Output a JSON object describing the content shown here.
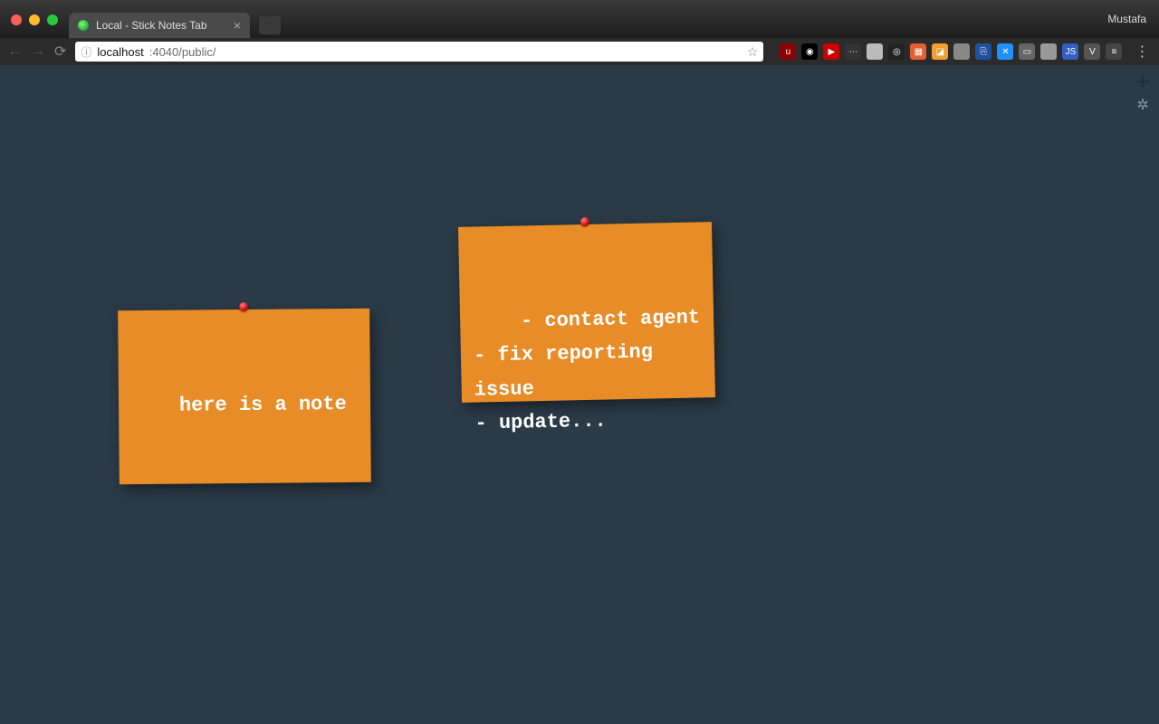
{
  "browser": {
    "tab_title": "Local - Stick Notes Tab",
    "profile_name": "Mustafa",
    "url_host": "localhost",
    "url_port_path": ":4040/public/",
    "secure_info_icon": "ⓘ",
    "star_icon": "☆"
  },
  "page_controls": {
    "add_icon": "＋",
    "settings_icon": "✲"
  },
  "notes": [
    {
      "text": "here is a note"
    },
    {
      "text": "- contact agent\n- fix reporting issue\n- update..."
    }
  ],
  "extensions": [
    {
      "name": "ublock",
      "bg": "#8b0000",
      "label": "u"
    },
    {
      "name": "ext-eye",
      "bg": "#000000",
      "label": "◉"
    },
    {
      "name": "youtube",
      "bg": "#cc0000",
      "label": "▶"
    },
    {
      "name": "ext-dots",
      "bg": "#333333",
      "label": "⋯"
    },
    {
      "name": "ext-circle",
      "bg": "#bbbbbb",
      "label": ""
    },
    {
      "name": "ext-target",
      "bg": "#222222",
      "label": "◎"
    },
    {
      "name": "ext-grid",
      "bg": "#e06030",
      "label": "▦"
    },
    {
      "name": "ext-orange",
      "bg": "#f0a030",
      "label": "◪"
    },
    {
      "name": "ext-gray1",
      "bg": "#888888",
      "label": ""
    },
    {
      "name": "ext-blue1",
      "bg": "#2050a0",
      "label": "⎘"
    },
    {
      "name": "ext-blue2",
      "bg": "#1e90ff",
      "label": "✕"
    },
    {
      "name": "ext-gray2",
      "bg": "#666666",
      "label": "▭"
    },
    {
      "name": "ext-gray3",
      "bg": "#999999",
      "label": ""
    },
    {
      "name": "ext-js",
      "bg": "#3060c0",
      "label": "JS"
    },
    {
      "name": "ext-v",
      "bg": "#555555",
      "label": "V"
    },
    {
      "name": "ext-lines",
      "bg": "#444444",
      "label": "≡"
    }
  ]
}
